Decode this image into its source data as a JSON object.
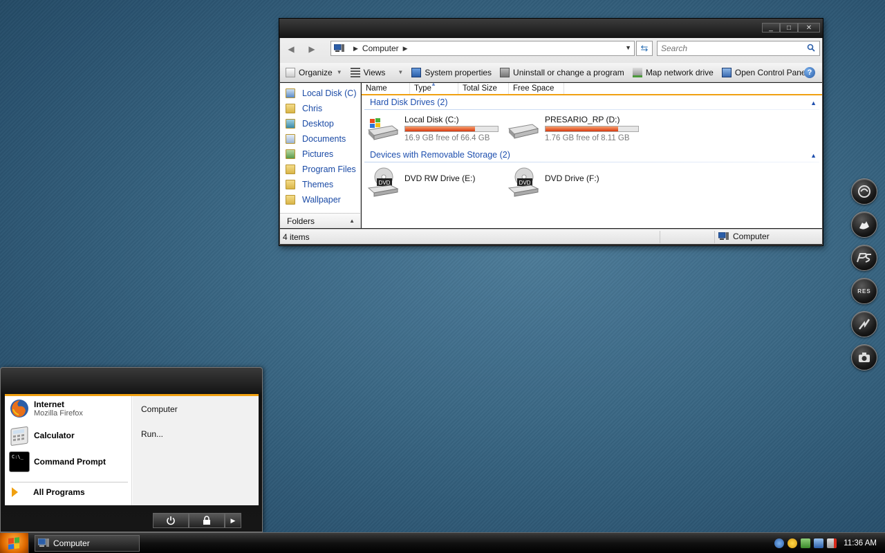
{
  "explorer": {
    "window_controls": {
      "minimize": "_",
      "maximize": "□",
      "close": "✕"
    },
    "address": {
      "crumbs": [
        "Computer"
      ]
    },
    "search": {
      "placeholder": "Search"
    },
    "toolbar": {
      "organize": "Organize",
      "views": "Views",
      "system_properties": "System properties",
      "uninstall": "Uninstall or change a program",
      "map_drive": "Map network drive",
      "control_panel": "Open Control Panel",
      "help": "?"
    },
    "nav_items": [
      {
        "label": "Local Disk (C)",
        "icon": "drive-icon"
      },
      {
        "label": "Chris",
        "icon": "folder-icon"
      },
      {
        "label": "Desktop",
        "icon": "desktop-icon"
      },
      {
        "label": "Documents",
        "icon": "documents-icon"
      },
      {
        "label": "Pictures",
        "icon": "pictures-icon"
      },
      {
        "label": "Program Files",
        "icon": "folder-icon"
      },
      {
        "label": "Themes",
        "icon": "folder-icon"
      },
      {
        "label": "Wallpaper",
        "icon": "folder-icon"
      }
    ],
    "folders_label": "Folders",
    "columns": [
      "Name",
      "Type",
      "Total Size",
      "Free Space"
    ],
    "groups": {
      "hard_disks": "Hard Disk Drives (2)",
      "removable": "Devices with Removable Storage (2)"
    },
    "drives": [
      {
        "name": "Local Disk (C:)",
        "free": "16.9 GB free of 66.4 GB",
        "used_fraction": 0.75
      },
      {
        "name": "PRESARIO_RP (D:)",
        "free": "1.76 GB free of 8.11 GB",
        "used_fraction": 0.78
      }
    ],
    "removable": [
      {
        "name": "DVD RW Drive (E:)",
        "badge": "DVD"
      },
      {
        "name": "DVD Drive (F:)",
        "badge": "DVD"
      }
    ],
    "status": {
      "count": "4 items",
      "location": "Computer"
    }
  },
  "start_menu": {
    "programs": [
      {
        "name": "Internet",
        "sub": "Mozilla Firefox"
      },
      {
        "name": "Calculator",
        "sub": ""
      },
      {
        "name": "Command Prompt",
        "sub": ""
      }
    ],
    "all_programs": "All Programs",
    "right_items": [
      "Computer",
      "Run..."
    ],
    "cmd_icon_text": "C:\\_"
  },
  "taskbar": {
    "task_label": "Computer",
    "clock": "11:36 AM"
  },
  "dock": {
    "icons": [
      "browser-icon",
      "swan-icon",
      "ps-icon",
      "res-icon",
      "bolt-icon",
      "camera-icon"
    ]
  },
  "colors": {
    "accent": "#f0a010",
    "link": "#1a4aa5"
  }
}
